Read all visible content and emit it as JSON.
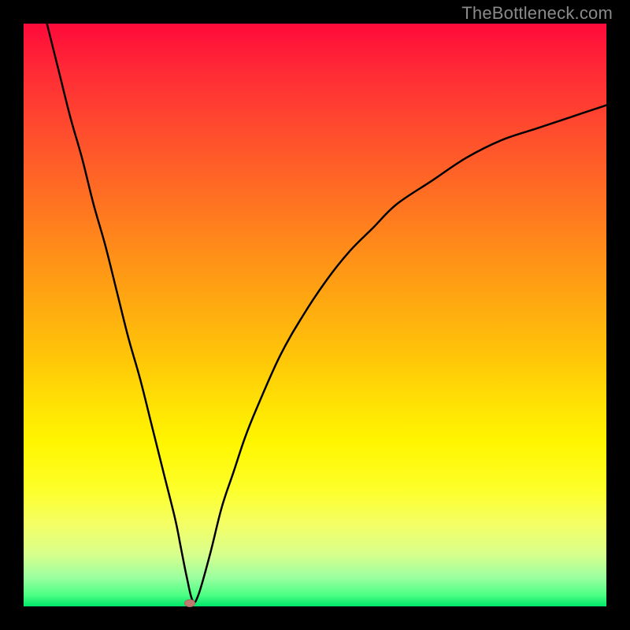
{
  "watermark": "TheBottleneck.com",
  "colors": {
    "frame": "#000000",
    "curve": "#000000",
    "marker": "#c17a6e",
    "gradient_stops": [
      "#ff0a3a",
      "#ff2a36",
      "#ff4b2e",
      "#ff6a24",
      "#ff8a1a",
      "#ffa910",
      "#ffc808",
      "#ffe404",
      "#fff600",
      "#fdff2a",
      "#f4ff66",
      "#d8ff8c",
      "#9cffa0",
      "#4eff84",
      "#00e86a"
    ]
  },
  "chart_data": {
    "type": "line",
    "title": "",
    "xlabel": "",
    "ylabel": "",
    "xlim": [
      0,
      100
    ],
    "ylim": [
      0,
      100
    ],
    "series": [
      {
        "name": "bottleneck-curve",
        "x": [
          4,
          6,
          8,
          10,
          12,
          14,
          16,
          18,
          20,
          22,
          24,
          26,
          27,
          28,
          29,
          30,
          32,
          34,
          36,
          38,
          40,
          44,
          48,
          52,
          56,
          60,
          64,
          70,
          76,
          82,
          88,
          94,
          100
        ],
        "y": [
          100,
          92,
          84,
          77,
          69,
          62,
          54,
          46,
          39,
          31,
          23,
          15,
          10,
          5,
          1,
          2,
          9,
          17,
          23,
          29,
          34,
          43,
          50,
          56,
          61,
          65,
          69,
          73,
          77,
          80,
          82,
          84,
          86
        ]
      }
    ],
    "marker": {
      "x": 28.5,
      "y": 0.5,
      "name": "optimal-point"
    },
    "grid": false,
    "legend": false
  }
}
